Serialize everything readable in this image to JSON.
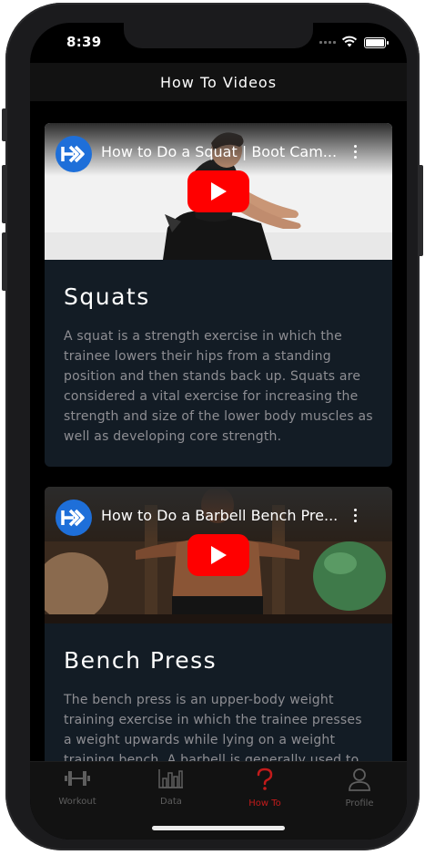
{
  "status_bar": {
    "time": "8:39"
  },
  "header": {
    "title": "How To Videos"
  },
  "cards": [
    {
      "video_title": "How to Do a Squat | Boot Cam...",
      "title": "Squats",
      "description": "A squat is a strength exercise in which the trainee lowers their hips from a standing position and then stands back up. Squats are considered a vital exercise for increasing the strength and size of the lower body muscles as well as developing core strength."
    },
    {
      "video_title": "How to Do a Barbell Bench Pre...",
      "title": "Bench Press",
      "description": "The bench press is an upper-body weight training exercise in which the trainee presses a weight upwards while lying on a weight training bench. A barbell is generally used to"
    }
  ],
  "tabs": [
    {
      "label": "Workout",
      "icon": "dumbbell-icon"
    },
    {
      "label": "Data",
      "icon": "bar-chart-icon"
    },
    {
      "label": "How To",
      "icon": "question-mark-icon"
    },
    {
      "label": "Profile",
      "icon": "person-icon"
    }
  ],
  "colors": {
    "active_tab": "#c21b1b",
    "youtube_red": "#ff0000",
    "card_bg": "#131c25"
  }
}
